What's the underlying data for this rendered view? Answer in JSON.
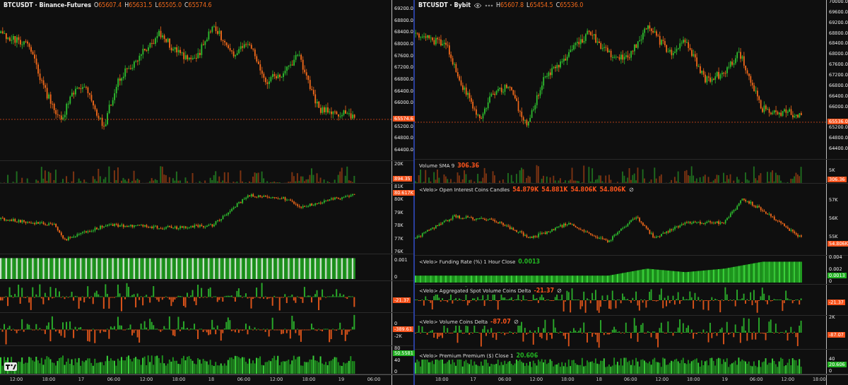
{
  "charts": [
    {
      "title": "BTCUSDT · Binance-Futures",
      "toolbar_icons": false,
      "ohlc": [
        {
          "label": "O",
          "value": "65607.4"
        },
        {
          "label": "H",
          "value": "65631.5"
        },
        {
          "label": "L",
          "value": "65505.0"
        },
        {
          "label": "C",
          "value": "65574.6"
        }
      ],
      "panes": [
        {
          "kind": "price",
          "ticks": [
            "69200.0",
            "68800.0",
            "68400.0",
            "68000.0",
            "67600.0",
            "67200.0",
            "66800.0",
            "66400.0",
            "66000.0",
            "65200.0",
            "64800.0",
            "64400.0"
          ],
          "last": {
            "text": "65574.6",
            "color": "#f7531c"
          }
        },
        {
          "kind": "volume",
          "ticks": [
            "20K"
          ],
          "last": {
            "text": "894.35",
            "color": "#f7531c"
          }
        },
        {
          "kind": "oi",
          "ticks": [
            "81K",
            "80K",
            "79K",
            "78K",
            "77K",
            "76K"
          ],
          "last": {
            "text": "80.617K",
            "color": "#f7531c"
          }
        },
        {
          "kind": "funding",
          "ticks": [
            "0.001",
            "0"
          ]
        },
        {
          "kind": "delta",
          "last": {
            "text": "-21.37",
            "color": "#f7531c"
          }
        },
        {
          "kind": "delta",
          "ticks": [
            "0",
            "-2K"
          ],
          "last": {
            "text": "-389.61",
            "color": "#f7531c"
          }
        },
        {
          "kind": "premium",
          "ticks": [
            "80",
            "40",
            "0"
          ],
          "last": {
            "text": "50.5581",
            "color": "#22b222"
          }
        }
      ],
      "time_axis": [
        "12:00",
        "18:00",
        "17",
        "06:00",
        "12:00",
        "18:00",
        "18",
        "06:00",
        "12:00",
        "18:00",
        "19",
        "06:00"
      ]
    },
    {
      "title": "BTCUSDT · Bybit",
      "toolbar_icons": true,
      "ohlc": [
        {
          "label": "H",
          "value": "65607.8"
        },
        {
          "label": "L",
          "value": "65454.5"
        },
        {
          "label": "C",
          "value": "65536.0"
        }
      ],
      "panes": [
        {
          "kind": "price",
          "ticks": [
            "70000.0",
            "69600.0",
            "69200.0",
            "68800.0",
            "68400.0",
            "68000.0",
            "67600.0",
            "67200.0",
            "66800.0",
            "66400.0",
            "66000.0",
            "65200.0",
            "64800.0",
            "64400.0"
          ],
          "last": {
            "text": "65536.0",
            "color": "#f7531c"
          }
        },
        {
          "kind": "volume",
          "legend": {
            "name": "Volume SMA 9",
            "settings_icon": false,
            "values": [
              {
                "text": "306.36",
                "color": "#f7531c"
              }
            ]
          },
          "ticks": [
            "5K"
          ],
          "last": {
            "text": "306.36",
            "color": "#f7531c"
          }
        },
        {
          "kind": "oi",
          "legend": {
            "name": "<Velo> Open Interest Coins Candles",
            "settings_icon": true,
            "values": [
              {
                "text": "54.879K",
                "color": "#f7531c"
              },
              {
                "text": "54.881K",
                "color": "#f7531c"
              },
              {
                "text": "54.806K",
                "color": "#f7531c"
              },
              {
                "text": "54.806K",
                "color": "#f7531c"
              }
            ]
          },
          "ticks": [
            "57K",
            "56K",
            "55K"
          ],
          "last": {
            "text": "54.806K",
            "color": "#f7531c"
          }
        },
        {
          "kind": "funding",
          "legend": {
            "name": "<Velo> Funding Rate (%) 1 Hour Close",
            "settings_icon": false,
            "values": [
              {
                "text": "0.0013",
                "color": "#22b222"
              }
            ]
          },
          "ticks": [
            "0.004",
            "0.002",
            "0"
          ],
          "last": {
            "text": "0.0013",
            "color": "#22b222"
          }
        },
        {
          "kind": "delta",
          "legend": {
            "name": "<Velo> Aggregated Spot Volume Coins Delta",
            "settings_icon": true,
            "values": [
              {
                "text": "-21.37",
                "color": "#f7531c"
              }
            ]
          },
          "last": {
            "text": "-21.37",
            "color": "#f7531c"
          }
        },
        {
          "kind": "delta",
          "legend": {
            "name": "<Velo> Volume Coins Delta",
            "settings_icon": true,
            "values": [
              {
                "text": "-87.07",
                "color": "#f7531c"
              }
            ]
          },
          "ticks": [
            "2K"
          ],
          "last": {
            "text": "-87.07",
            "color": "#f7531c"
          }
        },
        {
          "kind": "premium",
          "legend": {
            "name": "<Velo> Premium Premium ($) Close 1",
            "settings_icon": false,
            "values": [
              {
                "text": "20.606",
                "color": "#22b222"
              }
            ]
          },
          "ticks": [
            "40",
            "0"
          ],
          "last": {
            "text": "20.606",
            "color": "#22b222"
          }
        }
      ],
      "time_axis": [
        "18:00",
        "17",
        "06:00",
        "12:00",
        "18:00",
        "18",
        "06:00",
        "12:00",
        "18:00",
        "19",
        "06:00",
        "12:00",
        "18:00"
      ]
    }
  ]
}
